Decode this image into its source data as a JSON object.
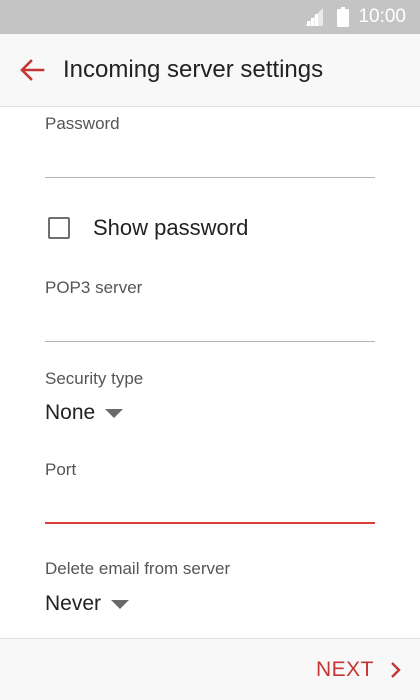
{
  "status_bar": {
    "time": "10:00",
    "signal_icon": "signal-icon",
    "battery_icon": "battery-icon"
  },
  "app_bar": {
    "back_icon": "arrow-left-icon",
    "title": "Incoming server settings"
  },
  "form": {
    "password": {
      "label": "Password",
      "value": "",
      "placeholder": ""
    },
    "show_password": {
      "label": "Show password",
      "checked": false
    },
    "pop3_server": {
      "label": "POP3 server",
      "value": "",
      "placeholder": ""
    },
    "security_type": {
      "label": "Security type",
      "selected": "None"
    },
    "port": {
      "label": "Port",
      "value": "",
      "placeholder": ""
    },
    "delete_email": {
      "label": "Delete email from server",
      "selected": "Never"
    }
  },
  "bottom_bar": {
    "next_label": "NEXT",
    "next_icon": "chevron-right-icon"
  },
  "colors": {
    "accent": "#d93d3d",
    "status_bar": "#c4c4c4",
    "app_bar": "#f8f8f8"
  }
}
